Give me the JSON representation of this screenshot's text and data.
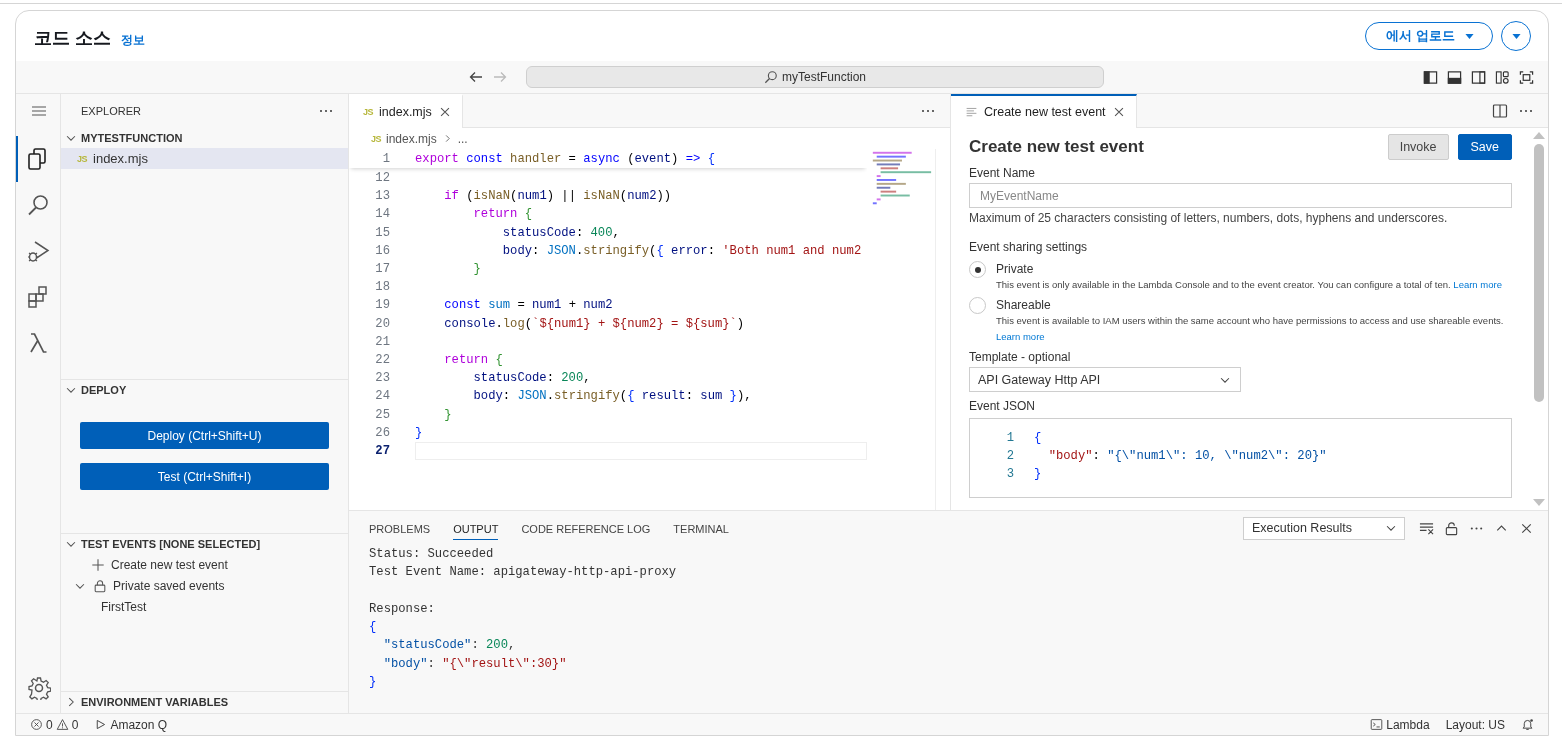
{
  "header": {
    "title": "코드 소스",
    "info_link": "정보",
    "upload_button": "에서 업로드"
  },
  "toolbar": {
    "search": "myTestFunction",
    "layout_toggles": [
      {
        "kind": "primary-sidebar",
        "on": true
      },
      {
        "kind": "panel",
        "on": true
      },
      {
        "kind": "secondary-sidebar",
        "on": false
      }
    ],
    "layout_actions": [
      {
        "kind": "customize"
      },
      {
        "kind": "fullscreen"
      }
    ]
  },
  "activity_bar": [
    {
      "kind": "menu",
      "selected": false
    },
    {
      "kind": "files",
      "selected": true
    },
    {
      "kind": "search",
      "selected": false
    },
    {
      "kind": "run",
      "selected": false
    },
    {
      "kind": "extensions",
      "selected": false
    },
    {
      "kind": "lambda",
      "selected": false
    },
    {
      "kind": "settings",
      "selected": false
    }
  ],
  "sidebar": {
    "explorer": {
      "title": "EXPLORER",
      "folder": {
        "name": "MYTESTFUNCTION",
        "expanded": true,
        "files": [
          {
            "name": "index.mjs",
            "badge": "JS",
            "selected": true
          }
        ]
      }
    },
    "deploy": {
      "title": "DEPLOY",
      "expanded": true,
      "buttons": [
        "Deploy (Ctrl+Shift+U)",
        "Test (Ctrl+Shift+I)"
      ]
    },
    "test_events": {
      "title": "TEST EVENTS [NONE SELECTED]",
      "expanded": true,
      "create": "Create new test event",
      "groups": [
        {
          "name": "Private saved events",
          "expanded": true,
          "items": [
            "FirstTest"
          ]
        }
      ]
    },
    "environment": {
      "title": "ENVIRONMENT VARIABLES",
      "expanded": false
    }
  },
  "editor": {
    "tabs": [
      {
        "label": "index.mjs",
        "badge": "JS",
        "selected": true
      }
    ],
    "breadcrumb": {
      "badge": "JS",
      "file": "index.mjs",
      "more": "..."
    },
    "sticky_line": {
      "num": "1",
      "tokens": [
        {
          "text": "export ",
          "kind": "keyword"
        },
        {
          "text": "const ",
          "kind": "storage"
        },
        {
          "text": "handler",
          "kind": "function"
        },
        {
          "text": " = ",
          "kind": "plain"
        },
        {
          "text": "async ",
          "kind": "storage"
        },
        {
          "text": "(",
          "kind": "plain"
        },
        {
          "text": "event",
          "kind": "variable"
        },
        {
          "text": ") ",
          "kind": "plain"
        },
        {
          "text": "=> ",
          "kind": "storage"
        },
        {
          "text": "{",
          "kind": "bracket"
        }
      ]
    },
    "lines": [
      {
        "num": "12",
        "current": false
      },
      {
        "num": "13",
        "current": false,
        "tokens": [
          {
            "text": "    if",
            "kind": "keyword"
          },
          {
            "text": " (",
            "kind": "plain"
          },
          {
            "text": "isNaN",
            "kind": "function"
          },
          {
            "text": "(",
            "kind": "plain"
          },
          {
            "text": "num1",
            "kind": "variable"
          },
          {
            "text": ") || ",
            "kind": "plain"
          },
          {
            "text": "isNaN",
            "kind": "function"
          },
          {
            "text": "(",
            "kind": "plain"
          },
          {
            "text": "num2",
            "kind": "variable"
          },
          {
            "text": "))",
            "kind": "plain"
          }
        ]
      },
      {
        "num": "14",
        "current": false,
        "tokens": [
          {
            "text": "        return ",
            "kind": "keyword"
          },
          {
            "text": "{",
            "kind": "bracket2"
          }
        ]
      },
      {
        "num": "15",
        "current": false,
        "tokens": [
          {
            "text": "            statusCode",
            "kind": "variable"
          },
          {
            "text": ": ",
            "kind": "plain"
          },
          {
            "text": "400",
            "kind": "number"
          },
          {
            "text": ",",
            "kind": "plain"
          }
        ]
      },
      {
        "num": "16",
        "current": false,
        "tokens": [
          {
            "text": "            body",
            "kind": "variable"
          },
          {
            "text": ": ",
            "kind": "plain"
          },
          {
            "text": "JSON",
            "kind": "constant"
          },
          {
            "text": ".",
            "kind": "plain"
          },
          {
            "text": "stringify",
            "kind": "function"
          },
          {
            "text": "(",
            "kind": "plain"
          },
          {
            "text": "{ ",
            "kind": "bracket"
          },
          {
            "text": "error",
            "kind": "variable"
          },
          {
            "text": ": ",
            "kind": "plain"
          },
          {
            "text": "'Both num1 and num2",
            "kind": "string"
          }
        ]
      },
      {
        "num": "17",
        "current": false,
        "tokens": [
          {
            "text": "        }",
            "kind": "bracket2"
          }
        ]
      },
      {
        "num": "18",
        "current": false
      },
      {
        "num": "19",
        "current": false,
        "tokens": [
          {
            "text": "    const ",
            "kind": "storage"
          },
          {
            "text": "sum",
            "kind": "constant"
          },
          {
            "text": " = ",
            "kind": "plain"
          },
          {
            "text": "num1",
            "kind": "variable"
          },
          {
            "text": " + ",
            "kind": "plain"
          },
          {
            "text": "num2",
            "kind": "variable"
          }
        ]
      },
      {
        "num": "20",
        "current": false,
        "tokens": [
          {
            "text": "    console",
            "kind": "variable"
          },
          {
            "text": ".",
            "kind": "plain"
          },
          {
            "text": "log",
            "kind": "function"
          },
          {
            "text": "(",
            "kind": "plain"
          },
          {
            "text": "`${num1} + ${num2} = ${sum}`",
            "kind": "string"
          },
          {
            "text": ")",
            "kind": "plain"
          }
        ]
      },
      {
        "num": "21",
        "current": false
      },
      {
        "num": "22",
        "current": false,
        "tokens": [
          {
            "text": "    return ",
            "kind": "keyword"
          },
          {
            "text": "{",
            "kind": "bracket2"
          }
        ]
      },
      {
        "num": "23",
        "current": false,
        "tokens": [
          {
            "text": "        statusCode",
            "kind": "variable"
          },
          {
            "text": ": ",
            "kind": "plain"
          },
          {
            "text": "200",
            "kind": "number"
          },
          {
            "text": ",",
            "kind": "plain"
          }
        ]
      },
      {
        "num": "24",
        "current": false,
        "tokens": [
          {
            "text": "        body",
            "kind": "variable"
          },
          {
            "text": ": ",
            "kind": "plain"
          },
          {
            "text": "JSON",
            "kind": "constant"
          },
          {
            "text": ".",
            "kind": "plain"
          },
          {
            "text": "stringify",
            "kind": "function"
          },
          {
            "text": "(",
            "kind": "plain"
          },
          {
            "text": "{ ",
            "kind": "bracket"
          },
          {
            "text": "result",
            "kind": "variable"
          },
          {
            "text": ": ",
            "kind": "plain"
          },
          {
            "text": "sum ",
            "kind": "variable"
          },
          {
            "text": "}",
            "kind": "bracket"
          },
          {
            "text": "),",
            "kind": "plain"
          }
        ]
      },
      {
        "num": "25",
        "current": false,
        "tokens": [
          {
            "text": "    }",
            "kind": "bracket2"
          }
        ]
      },
      {
        "num": "26",
        "current": false,
        "tokens": [
          {
            "text": "}",
            "kind": "bracket"
          }
        ]
      },
      {
        "num": "27",
        "current": true
      }
    ]
  },
  "test_event": {
    "tabs": [
      {
        "label": "Create new test event",
        "selected": true
      }
    ],
    "title": "Create new test event",
    "buttons": [
      {
        "label": "Invoke",
        "kind": "secondary"
      },
      {
        "label": "Save",
        "kind": "primary"
      }
    ],
    "event_name": {
      "label": "Event Name",
      "placeholder": "MyEventName",
      "hint": "Maximum of 25 characters consisting of letters, numbers, dots, hyphens and underscores."
    },
    "sharing": {
      "label": "Event sharing settings",
      "options": [
        {
          "label": "Private",
          "selected": true,
          "description": "This event is only available in the Lambda Console and to the event creator. You can configure a total of ten.",
          "link": "Learn more"
        },
        {
          "label": "Shareable",
          "selected": false,
          "description": "This event is available to IAM users within the same account who have permissions to access and use shareable events.",
          "link": "Learn more"
        }
      ]
    },
    "template": {
      "label": "Template - optional",
      "value": "API Gateway Http API"
    },
    "event_json": {
      "label": "Event JSON",
      "lines": [
        {
          "num": "1",
          "tokens": [
            {
              "text": "{",
              "kind": "bracket"
            }
          ]
        },
        {
          "num": "2",
          "tokens": [
            {
              "text": "  \"body\"",
              "kind": "string"
            },
            {
              "text": ": ",
              "kind": "plain"
            },
            {
              "text": "\"{\\\"num1\\\": 10, \\\"num2\\\": 20}\"",
              "kind": "property"
            }
          ]
        },
        {
          "num": "3",
          "tokens": [
            {
              "text": "}",
              "kind": "bracket"
            }
          ]
        }
      ]
    }
  },
  "panel": {
    "tabs": [
      {
        "label": "PROBLEMS",
        "selected": false
      },
      {
        "label": "OUTPUT",
        "selected": true
      },
      {
        "label": "CODE REFERENCE LOG",
        "selected": false
      },
      {
        "label": "TERMINAL",
        "selected": false
      }
    ],
    "channel": "Execution Results",
    "output": [
      {
        "lines": [
          [
            {
              "text": "Status: Succeeded",
              "kind": "plain"
            }
          ],
          [
            {
              "text": "Test Event Name: apigateway-http-api-proxy",
              "kind": "plain"
            }
          ]
        ]
      },
      {
        "lines": [
          [
            {
              "text": "Response:",
              "kind": "plain"
            }
          ],
          [
            {
              "text": "{",
              "kind": "bracket"
            }
          ],
          [
            {
              "text": "  \"statusCode\"",
              "kind": "property"
            },
            {
              "text": ": ",
              "kind": "plain"
            },
            {
              "text": "200",
              "kind": "number"
            },
            {
              "text": ",",
              "kind": "plain"
            }
          ],
          [
            {
              "text": "  \"body\"",
              "kind": "property"
            },
            {
              "text": ": ",
              "kind": "plain"
            },
            {
              "text": "\"{\\\"result\\\":30}\"",
              "kind": "string"
            }
          ],
          [
            {
              "text": "}",
              "kind": "bracket"
            }
          ]
        ]
      }
    ]
  },
  "status_bar": {
    "errors": "0",
    "warnings": "0",
    "assistant": "Amazon Q",
    "terminal": "Lambda",
    "layout": "Layout: US"
  }
}
